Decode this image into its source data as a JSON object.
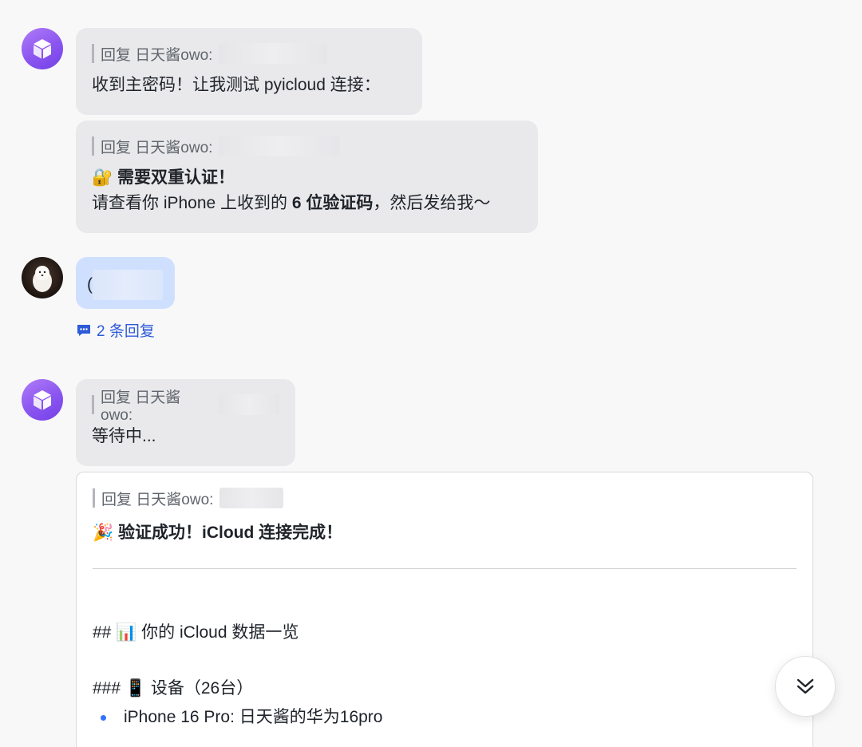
{
  "messages": [
    {
      "sender": "bot",
      "reply_prefix": "回复 日天酱owo:",
      "text": "收到主密码！让我测试 pyicloud 连接："
    },
    {
      "sender": "bot",
      "reply_prefix": "回复 日天酱owo:",
      "emoji": "🔐",
      "title": "需要双重认证！",
      "line2_a": "请查看你 iPhone 上收到的 ",
      "line2_b": "6 位验证码",
      "line2_c": "，然后发给我～"
    },
    {
      "sender": "user",
      "text": "(",
      "reply_count_label": "2 条回复"
    },
    {
      "sender": "bot",
      "reply_prefix": "回复 日天酱owo:",
      "text": "等待中..."
    },
    {
      "sender": "bot",
      "reply_prefix": "回复 日天酱owo:",
      "emoji": "🎉",
      "title": "验证成功！iCloud 连接完成！",
      "h2": "## 📊 你的 iCloud 数据一览",
      "h3": "### 📱 设备（26台）",
      "bullet1": "iPhone 16 Pro: 日天酱的华为16pro"
    }
  ],
  "icons": {
    "bot_avatar": "cube-icon",
    "user_avatar": "dog-photo",
    "replies": "comment-icon",
    "scroll": "double-chevron-down-icon"
  },
  "colors": {
    "accent": "#2f5bd8",
    "bot_avatar": "#8a55f0",
    "self_bubble": "#cfe0ff"
  }
}
